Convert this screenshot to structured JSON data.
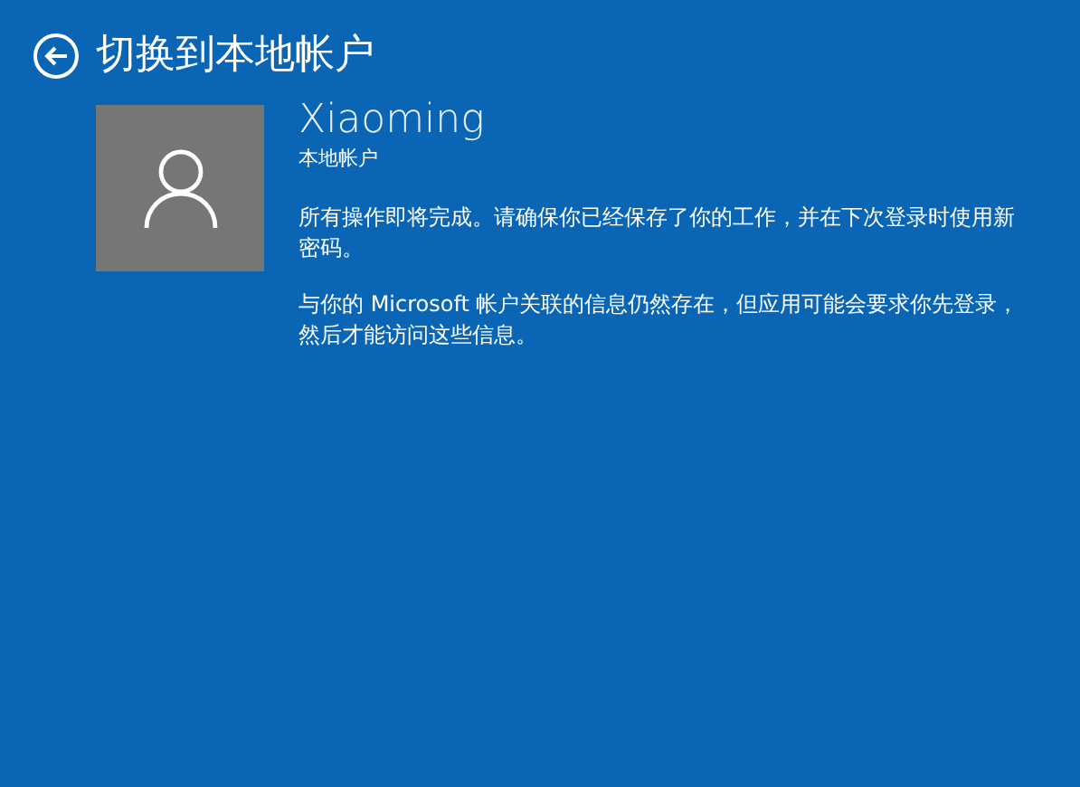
{
  "header": {
    "title": "切换到本地帐户"
  },
  "account": {
    "name": "Xiaoming",
    "type": "本地帐户"
  },
  "paragraphs": [
    "所有操作即将完成。请确保你已经保存了你的工作，并在下次登录时使用新密码。",
    "与你的 Microsoft 帐户关联的信息仍然存在，但应用可能会要求你先登录，然后才能访问这些信息。"
  ]
}
